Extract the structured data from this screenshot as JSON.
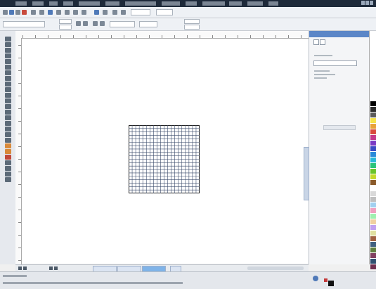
{
  "menubar": {
    "title": "",
    "items": [
      "",
      "",
      "",
      "",
      "",
      "",
      "",
      "",
      "",
      "",
      "",
      "",
      ""
    ]
  },
  "toolbar": {
    "zoom_value": "",
    "units_value": ""
  },
  "docker": {
    "title": "",
    "selected_option": "",
    "button_label": ""
  },
  "pages": {
    "count_label": "",
    "tabs": [
      "",
      "",
      "",
      ""
    ],
    "active_index": 2
  },
  "status": {
    "cursor_position": "",
    "document_info": ""
  },
  "canvas": {
    "object": "grid",
    "grid_columns": 20,
    "grid_rows": 20
  },
  "palette": {
    "colors": [
      "#000000",
      "#2d2d2d",
      "#5a5a5a",
      "#f5e34a",
      "#e8a23a",
      "#d94a3c",
      "#c43a8a",
      "#7a3ac4",
      "#3a4ac4",
      "#2a8ad9",
      "#2ab8d9",
      "#2ac47a",
      "#6ac42a",
      "#c4d92a",
      "#8a5a2a",
      "#ffffff",
      "#d9d9d9",
      "#bfbfbf",
      "#a0d0f0",
      "#f0a0c0",
      "#a0f0b0",
      "#f0d0a0",
      "#c0a0f0",
      "#e0e0a0",
      "#a06040",
      "#406080",
      "#608040",
      "#804060",
      "#305070",
      "#703050"
    ]
  },
  "colors": {
    "accent": "#5b86c7",
    "fill": "#c43a3a",
    "outline": "#111111"
  }
}
